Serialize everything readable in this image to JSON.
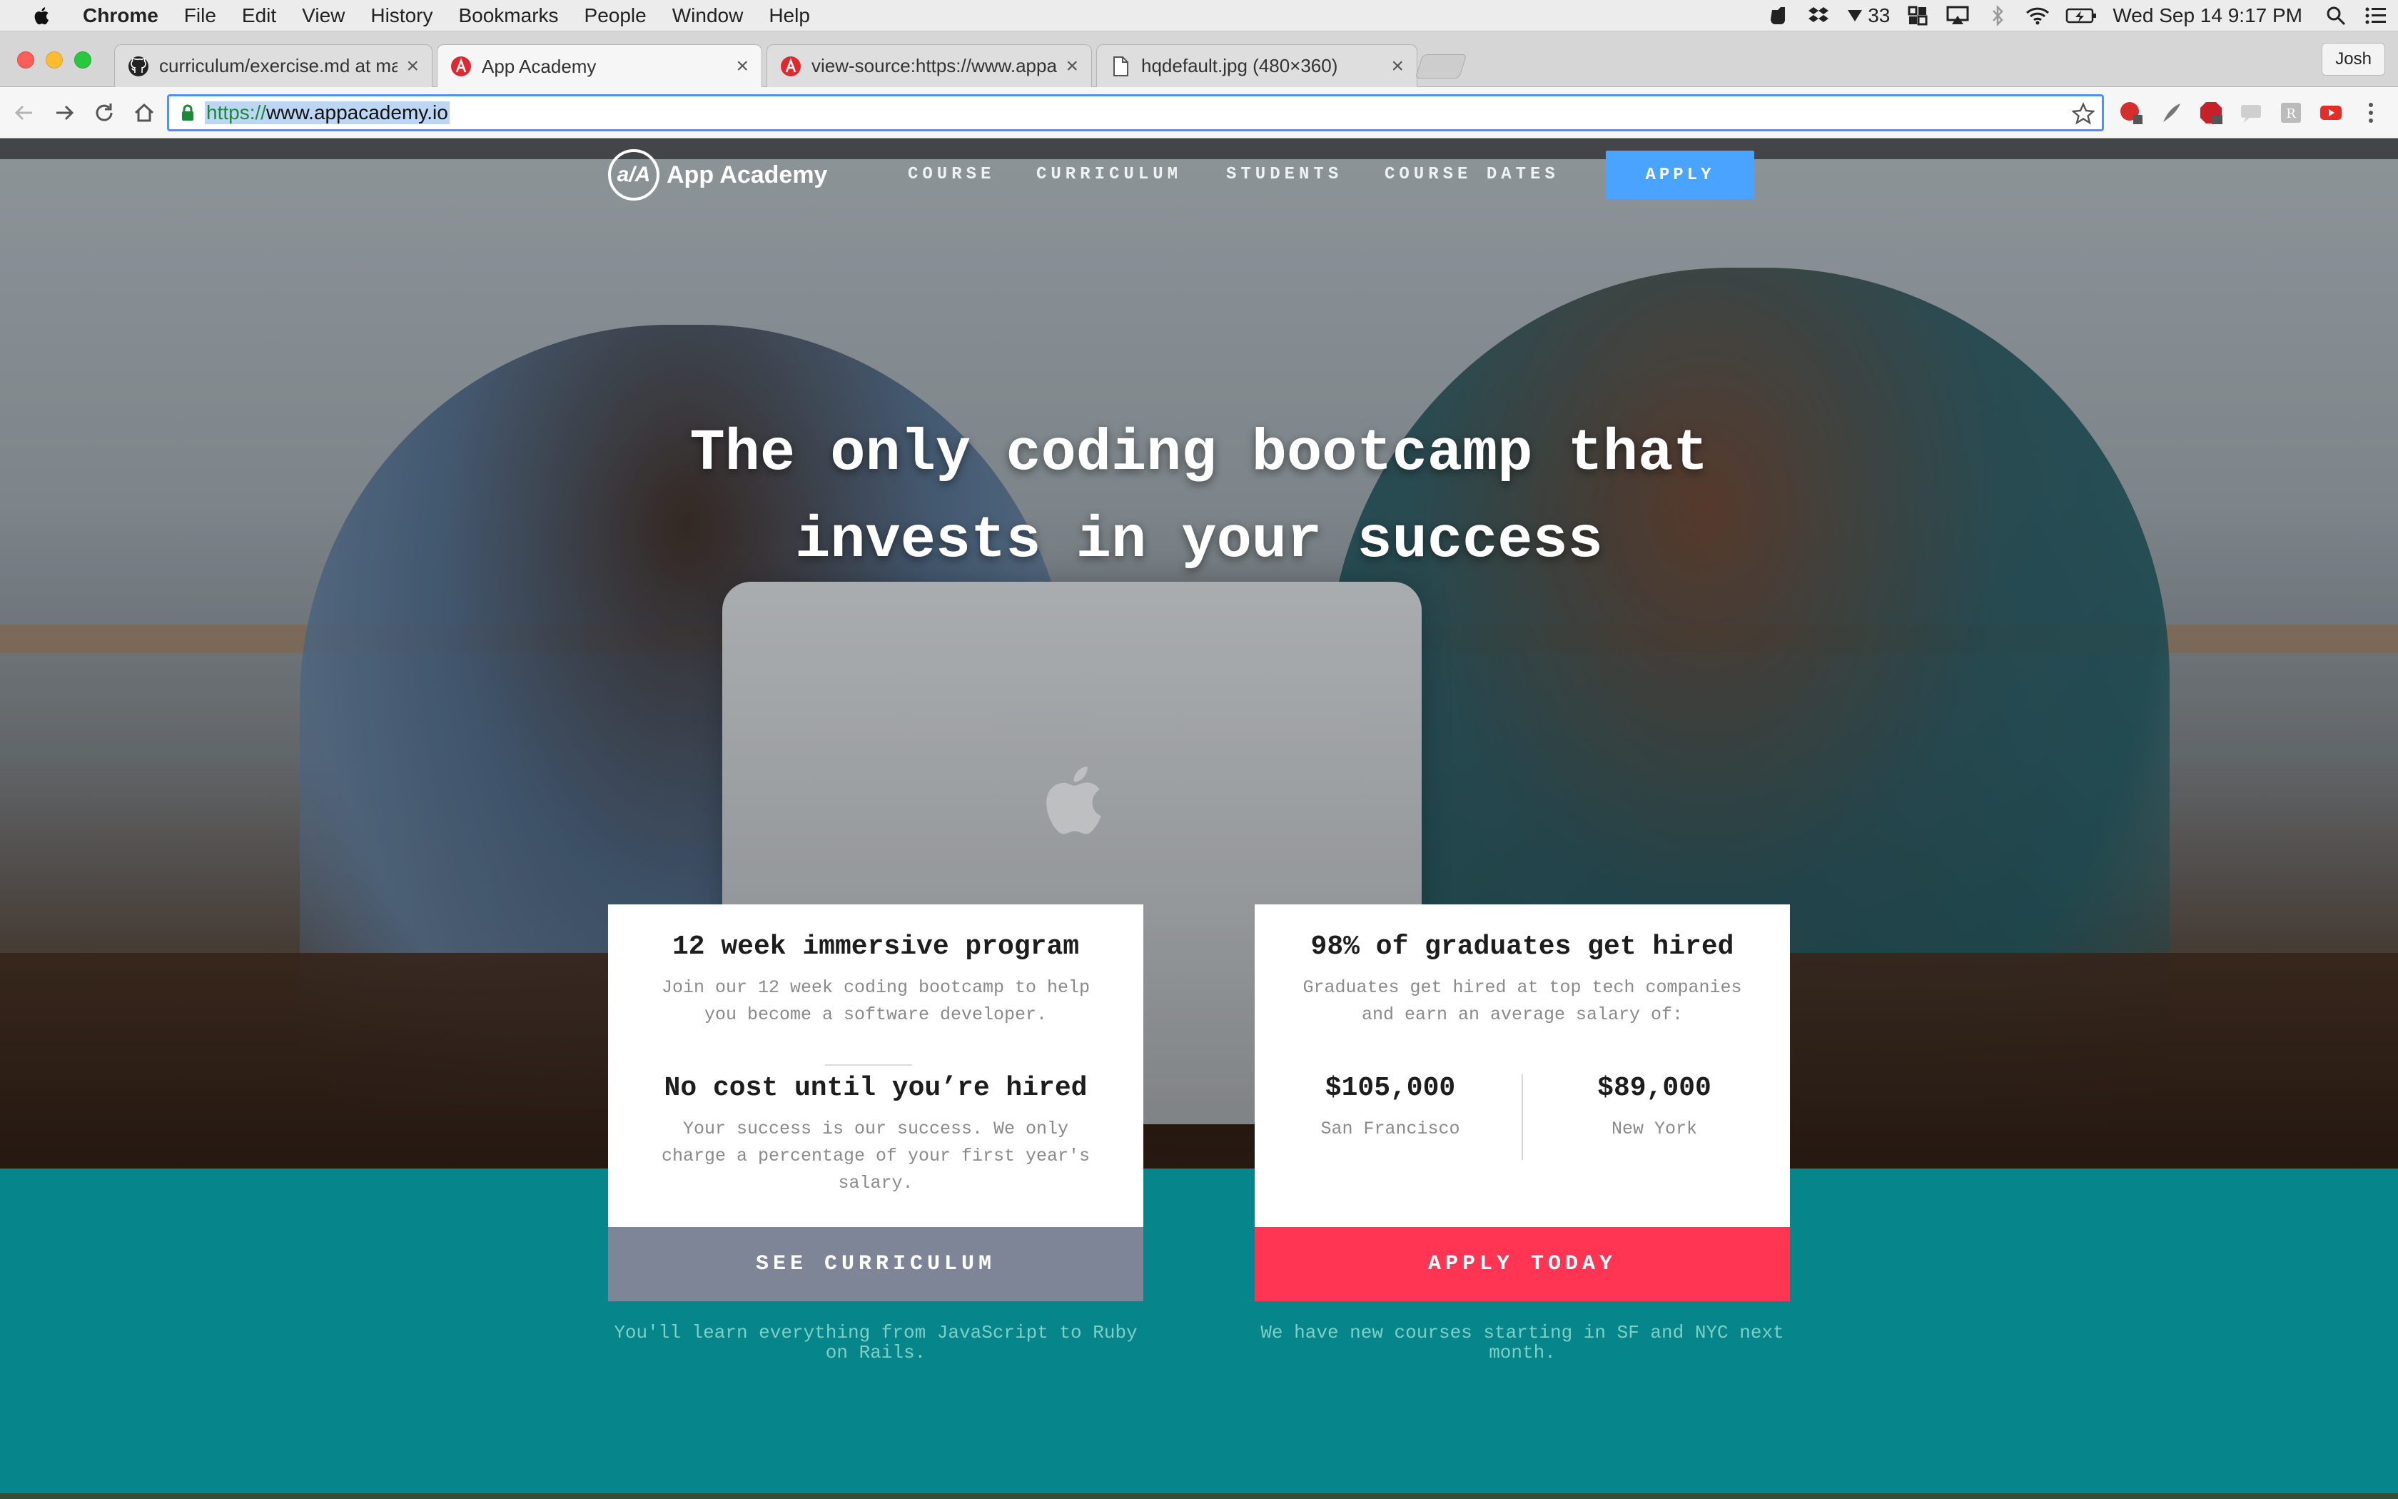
{
  "menubar": {
    "app_name": "Chrome",
    "items": [
      "File",
      "Edit",
      "View",
      "History",
      "Bookmarks",
      "People",
      "Window",
      "Help"
    ],
    "notification_count": "33",
    "datetime": "Wed Sep 14  9:17 PM",
    "user": "Josh"
  },
  "tabs": [
    {
      "title": "curriculum/exercise.md at mas",
      "icon": "github-icon"
    },
    {
      "title": "App Academy",
      "icon": "app-academy-icon"
    },
    {
      "title": "view-source:https://www.appa",
      "icon": "app-academy-icon"
    },
    {
      "title": "hqdefault.jpg (480×360)",
      "icon": "document-icon"
    }
  ],
  "omnibox": {
    "scheme": "https://",
    "host": "www.appacademy.io"
  },
  "site": {
    "brand": "App Academy",
    "brand_logo": "a/A",
    "nav": [
      "COURSE",
      "CURRICULUM",
      "STUDENTS",
      "COURSE DATES"
    ],
    "apply_label": "APPLY",
    "headline_line1": "The only coding bootcamp that",
    "headline_line2": "invests in your success",
    "colors": {
      "teal": "#06858a",
      "apply_blue": "#4aa3ff",
      "apply_red": "#ff3553",
      "curriculum_gray": "#7d8596"
    }
  },
  "card_program": {
    "title": "12 week immersive program",
    "text": "Join our 12 week coding bootcamp to help you become a software developer.",
    "title2": "No cost until you’re hired",
    "text2": "Your success is our success. We only charge a percentage of your first year's salary.",
    "button": "SEE CURRICULUM",
    "note": "You'll learn everything from JavaScript to Ruby on Rails."
  },
  "card_hired": {
    "title": "98% of graduates get hired",
    "text": "Graduates get hired at top tech companies and earn an average salary of:",
    "salaries": [
      {
        "amount": "$105,000",
        "city": "San Francisco"
      },
      {
        "amount": "$89,000",
        "city": "New York"
      }
    ],
    "button": "APPLY TODAY",
    "note": "We have new courses starting in SF and NYC next month."
  }
}
